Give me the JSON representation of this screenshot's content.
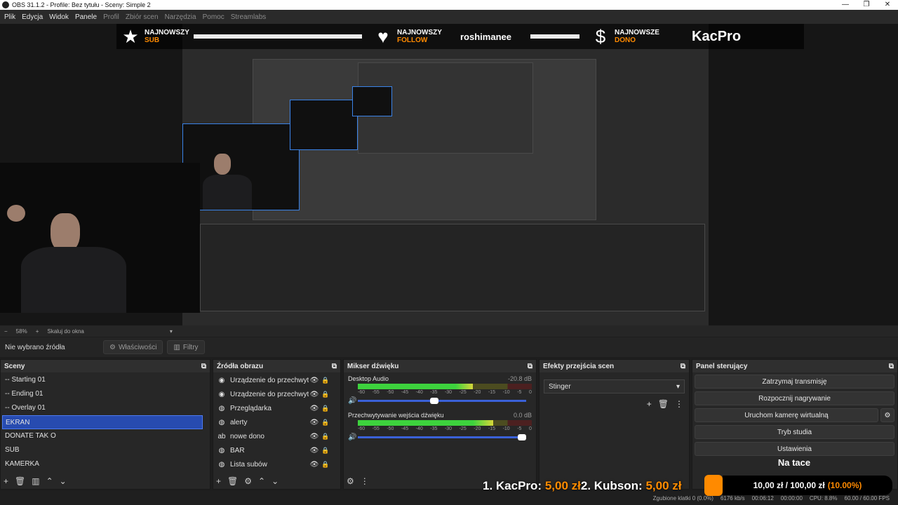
{
  "window": {
    "title": "OBS 31.1.2 - Profile: Bez tytułu - Sceny: Simple 2",
    "minimize": "—",
    "restore": "❐",
    "close": "✕"
  },
  "menu": {
    "items": [
      "Plik",
      "Edycja",
      "Widok",
      "Panele",
      "Profil",
      "Zbiór scen",
      "Narzędzia",
      "Pomoc",
      "Streamlabs"
    ]
  },
  "alerts": {
    "sub": {
      "top": "NAJNOWSZY",
      "bottom": "SUB"
    },
    "follow": {
      "top": "NAJNOWSZY",
      "bottom": "FOLLOW",
      "name": "roshimanee"
    },
    "dono": {
      "top": "NAJNOWSZE",
      "bottom": "DONO",
      "name": "KacPro"
    }
  },
  "zoom": {
    "value": "58%",
    "scale_mode": "Skaluj do okna"
  },
  "source_toolbar": {
    "no_source": "Nie wybrano źródła",
    "properties": "Właściwości",
    "filters": "Filtry"
  },
  "scenes": {
    "title": "Sceny",
    "items": [
      "-- Starting 01",
      "-- Ending 01",
      "-- Overlay 01",
      "EKRAN",
      "DONATE TAK O",
      "SUB",
      "KAMERKA"
    ],
    "selected_index": 3
  },
  "sources": {
    "title": "Źródła obrazu",
    "items": [
      {
        "icon": "camera-icon",
        "glyph": "◉",
        "name": "Urządzenie do przechwytywania"
      },
      {
        "icon": "camera-icon",
        "glyph": "◉",
        "name": "Urządzenie do przechwytywania"
      },
      {
        "icon": "browser-icon",
        "glyph": "◍",
        "name": "Przeglądarka"
      },
      {
        "icon": "browser-icon",
        "glyph": "◍",
        "name": "alerty"
      },
      {
        "icon": "text-icon",
        "glyph": "ab",
        "name": "nowe dono"
      },
      {
        "icon": "browser-icon",
        "glyph": "◍",
        "name": "BAR"
      },
      {
        "icon": "browser-icon",
        "glyph": "◍",
        "name": "Lista subów"
      }
    ]
  },
  "mixer": {
    "title": "Mikser dźwięku",
    "scale": [
      "-60",
      "-55",
      "-50",
      "-45",
      "-40",
      "-35",
      "-30",
      "-25",
      "-20",
      "-15",
      "-10",
      "-5",
      "0"
    ],
    "channels": [
      {
        "name": "Desktop Audio",
        "db": "-20.8 dB",
        "level": 0.66,
        "volume": 0.48
      },
      {
        "name": "Przechwytywanie wejścia dźwięku",
        "db": "0.0 dB",
        "level": 0.78,
        "volume": 1.0
      }
    ]
  },
  "transitions": {
    "title": "Efekty przejścia scen",
    "selected": "Stinger"
  },
  "controls": {
    "title": "Panel sterujący",
    "buttons": [
      "Zatrzymaj transmisję",
      "Rozpocznij nagrywanie",
      "Uruchom kamerę wirtualną",
      "Tryb studia",
      "Ustawienia"
    ],
    "on_tray": "Na tace"
  },
  "overlay": {
    "rank1_name": "1. KacPro:",
    "rank1_amount": "5,00 zł",
    "rank2_name": "2. Kubson:",
    "rank2_amount": "5,00 zł",
    "goal": "10,00 zł / 100,00 zł",
    "goal_pct": "(10.00%)"
  },
  "status": {
    "dropped": "Zgubione klatki 0 (0.0%)",
    "kbps": "6176 kb/s",
    "live_time": "00:06:12",
    "rec_time": "00:00:00",
    "cpu": "CPU: 8.8%",
    "fps": "60.00 / 60.00 FPS"
  },
  "colors": {
    "accent": "#274bb0",
    "orange": "#ff8a00",
    "meter_green": "#3dd23d"
  }
}
